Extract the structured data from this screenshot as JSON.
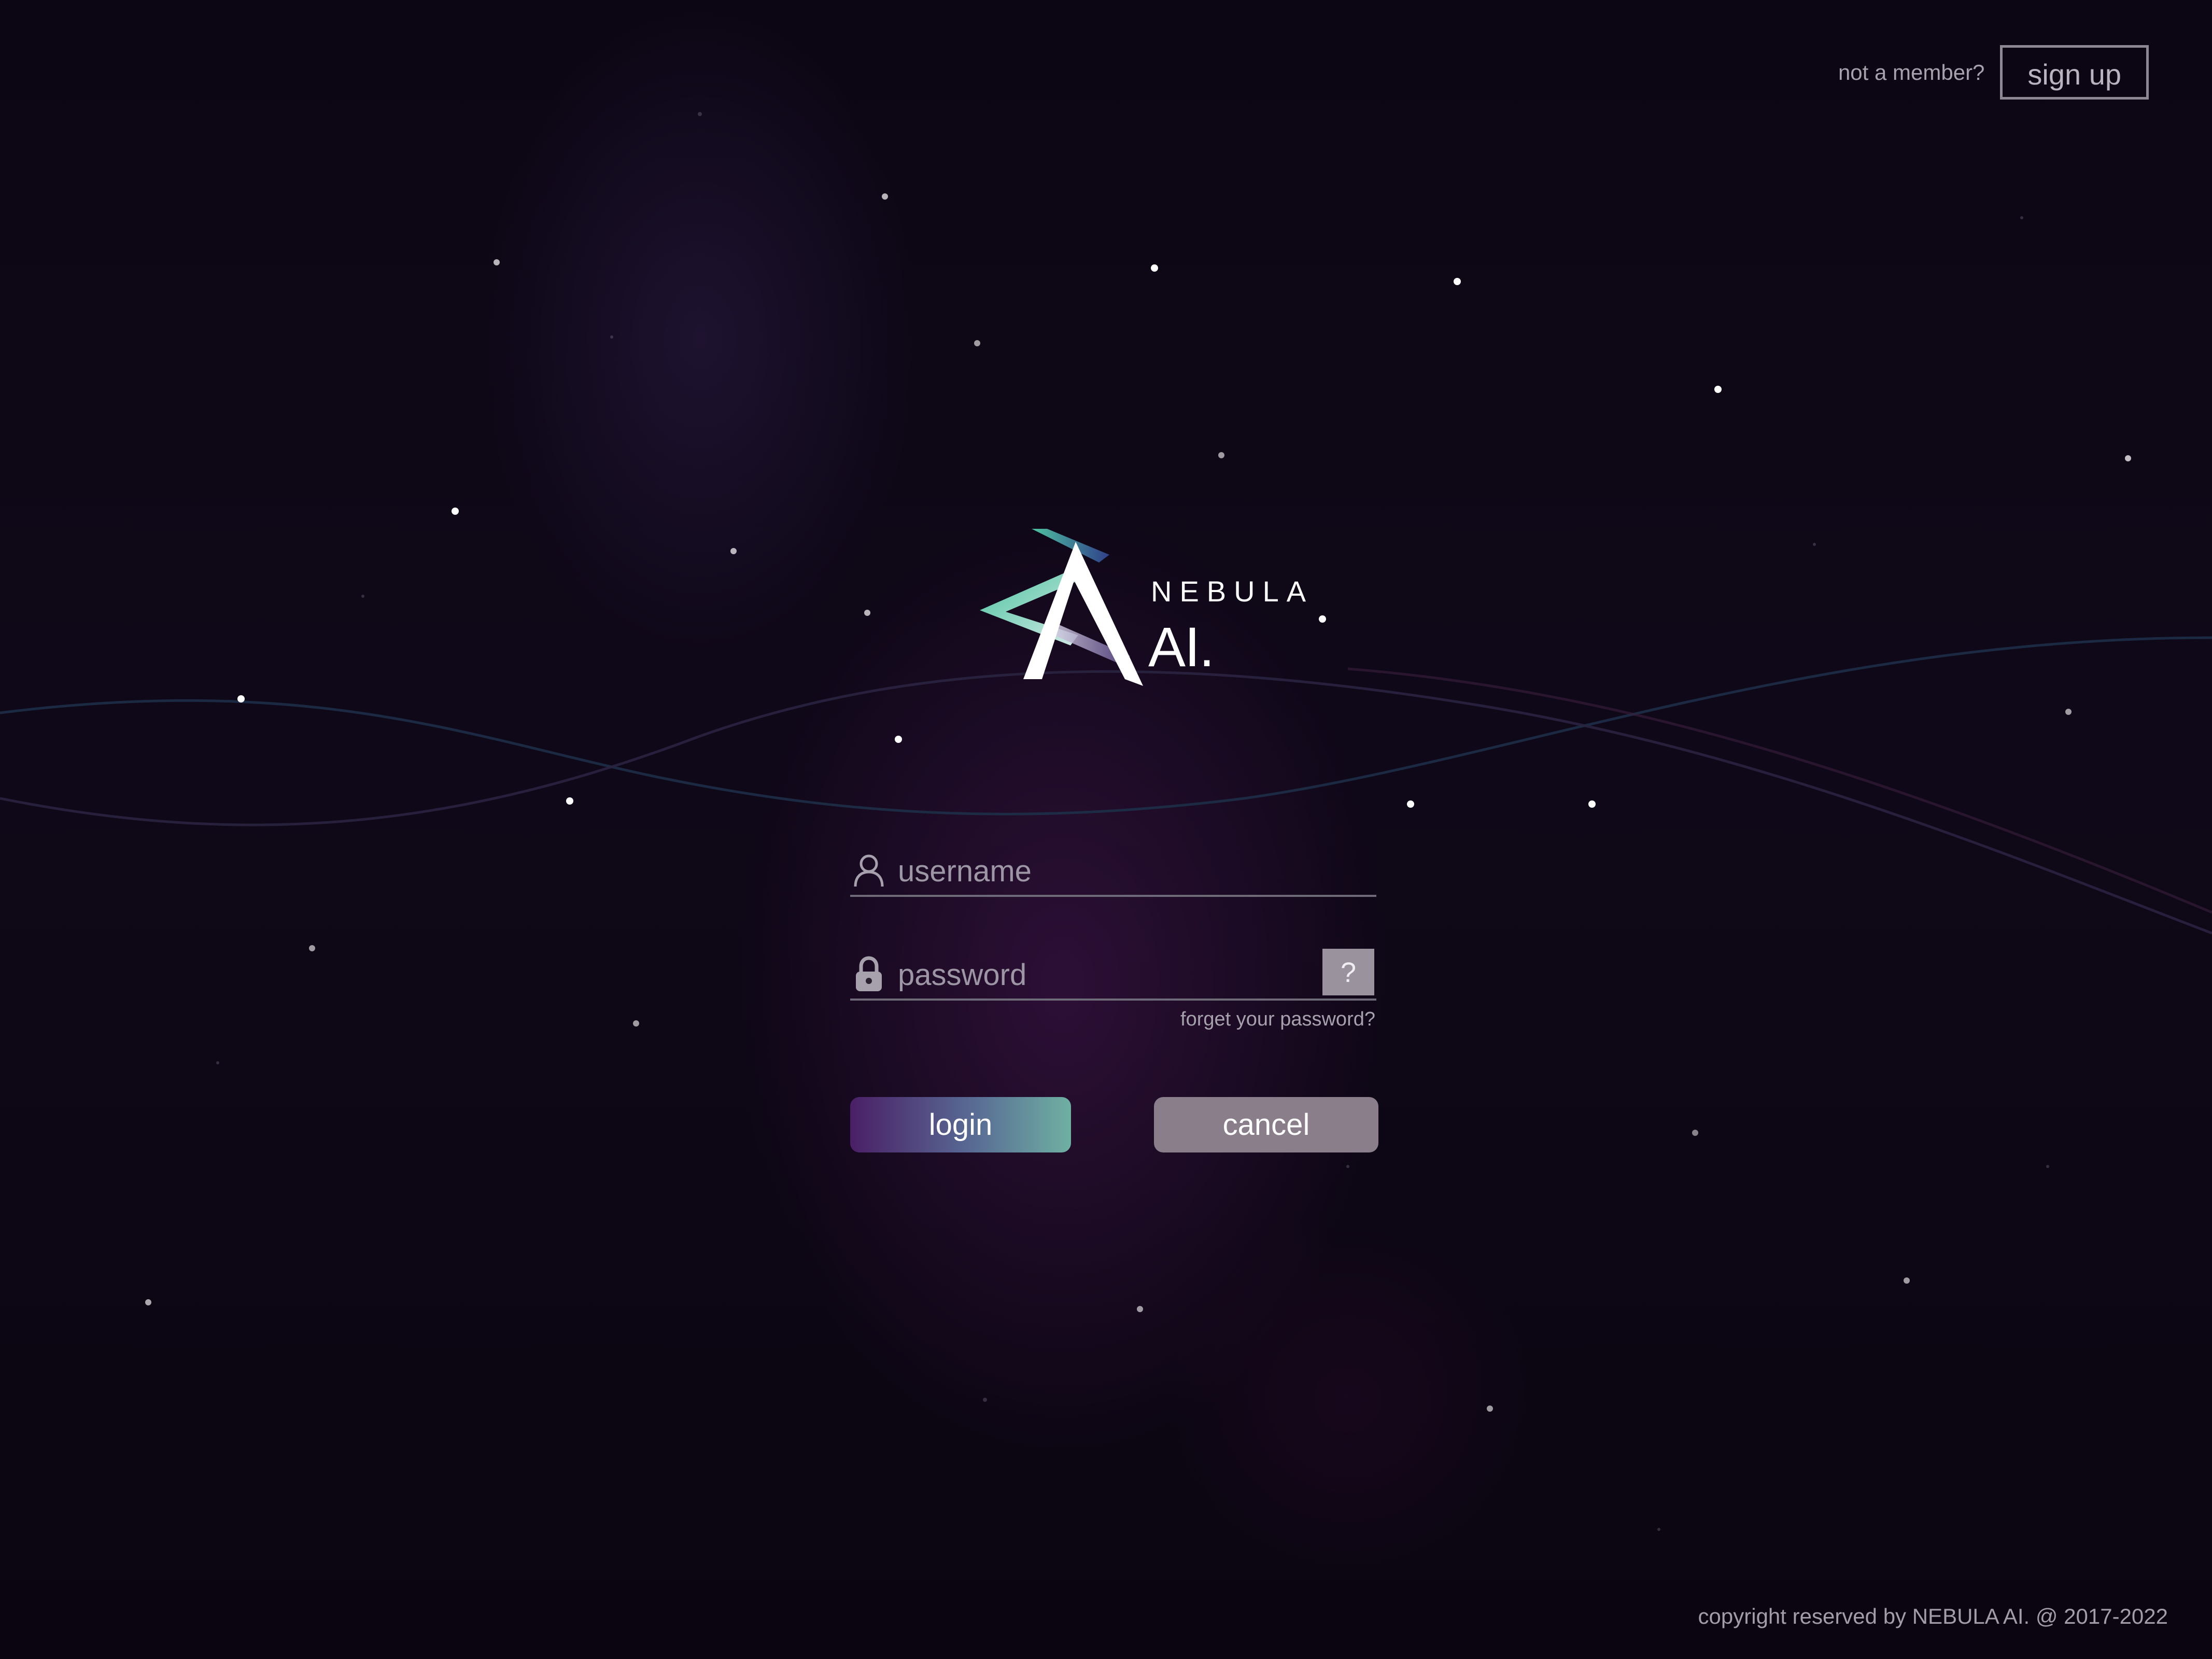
{
  "header": {
    "not_member_text": "not a member?",
    "signup_label": "sign up"
  },
  "logo": {
    "brand_top": "NEBULA",
    "brand_bottom": "AI.",
    "icon_name": "nebula-logo-icon"
  },
  "form": {
    "username_placeholder": "username",
    "password_placeholder": "password",
    "help_label": "?",
    "forgot_label": "forget your password?",
    "login_label": "login",
    "cancel_label": "cancel"
  },
  "footer": {
    "copyright": "copyright reserved by NEBULA AI. @ 2017-2022"
  },
  "colors": {
    "background": "#0c0614",
    "login_gradient_start": "#4a1f66",
    "login_gradient_end": "#6fb0a2",
    "cancel_button": "#8a7e8b",
    "help_button": "#9a939e"
  }
}
